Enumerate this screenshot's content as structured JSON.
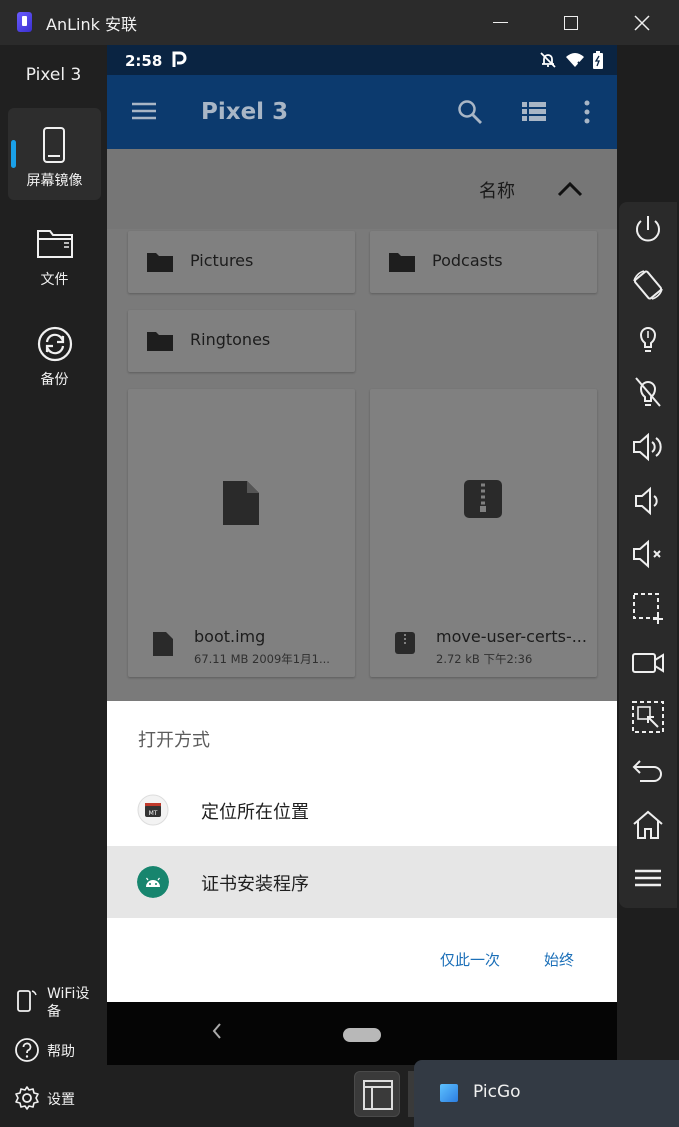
{
  "window": {
    "title": "AnLink 安联"
  },
  "sidebar": {
    "device_name": "Pixel 3",
    "nav": [
      {
        "label": "屏幕镜像",
        "icon": "phone-icon",
        "active": true
      },
      {
        "label": "文件",
        "icon": "folder-icon",
        "active": false
      },
      {
        "label": "备份",
        "icon": "sync-icon",
        "active": false
      }
    ],
    "bottom": [
      {
        "label_line1": "WiFi设",
        "label_line2": "备",
        "icon": "wifi-device-icon"
      },
      {
        "label": "帮助",
        "icon": "help-icon"
      },
      {
        "label": "设置",
        "icon": "gear-icon"
      }
    ]
  },
  "phone": {
    "status": {
      "time": "2:58"
    },
    "appbar": {
      "title": "Pixel 3"
    },
    "sort": {
      "label": "名称"
    },
    "folders": [
      "Pictures",
      "Podcasts",
      "Ringtones"
    ],
    "files": [
      {
        "name": "boot.img",
        "meta": "67.11 MB 2009年1月1...",
        "icon": "file-icon"
      },
      {
        "name": "move-user-certs-...",
        "meta": "2.72 kB 下午2:36",
        "icon": "zip-icon"
      }
    ],
    "dialog": {
      "title": "打开方式",
      "options": [
        {
          "label": "定位所在位置",
          "icon": "mt-manager-icon",
          "selected": false
        },
        {
          "label": "证书安装程序",
          "icon": "android-icon",
          "selected": true
        }
      ],
      "just_once": "仅此一次",
      "always": "始终"
    }
  },
  "right_toolbar": [
    "power-icon",
    "rotate-icon",
    "light-on-icon",
    "light-off-icon",
    "volume-up-icon",
    "volume-down-icon",
    "mute-icon",
    "screenshot-icon",
    "record-icon",
    "region-capture-icon",
    "back-icon",
    "home-icon",
    "menu-icon"
  ],
  "taskbar": {
    "popup_label": "PicGo"
  },
  "colors": {
    "accent": "#1aa0e8",
    "appbar": "#0c3a6e",
    "link": "#1b6fb8"
  }
}
